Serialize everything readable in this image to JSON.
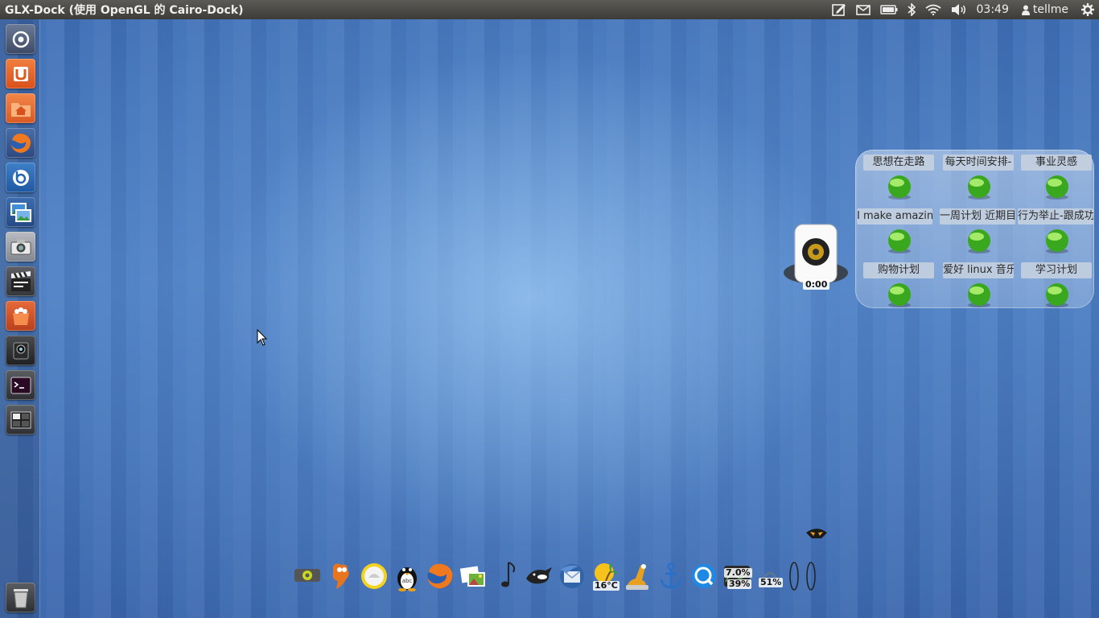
{
  "top_panel": {
    "window_title": "GLX-Dock (使用 OpenGL 的 Cairo-Dock)",
    "clock": "03:49",
    "user": "tellme",
    "icons": [
      "notes-icon",
      "mail-icon",
      "battery-icon",
      "bluetooth-icon",
      "wifi-icon",
      "volume-icon",
      "user-icon",
      "power-gear-icon"
    ]
  },
  "launcher": {
    "items": [
      {
        "name": "dash-home-icon"
      },
      {
        "name": "ubuntu-software-center-icon"
      },
      {
        "name": "home-folder-icon"
      },
      {
        "name": "firefox-icon"
      },
      {
        "name": "blue-app-icon"
      },
      {
        "name": "image-viewer-icon"
      },
      {
        "name": "camera-icon"
      },
      {
        "name": "video-editor-icon"
      },
      {
        "name": "orange-app-icon"
      },
      {
        "name": "webcam-icon"
      },
      {
        "name": "terminal-icon"
      },
      {
        "name": "workspace-switcher-icon"
      },
      {
        "name": "trash-icon"
      }
    ]
  },
  "audio_widget": {
    "time": "0:00"
  },
  "notes_panel": {
    "notes": [
      {
        "label": "思想在走路"
      },
      {
        "label": "每天时间安排-"
      },
      {
        "label": "事业灵感"
      },
      {
        "label": "I make amazing"
      },
      {
        "label": "一周计划 近期目"
      },
      {
        "label": "行为举止-跟成功"
      },
      {
        "label": "购物计划"
      },
      {
        "label": "爱好 linux 音乐"
      },
      {
        "label": "学习计划"
      }
    ]
  },
  "dock": {
    "items": [
      {
        "name": "system-settings-icon"
      },
      {
        "name": "gimp-icon"
      },
      {
        "name": "yellow-circle-icon"
      },
      {
        "name": "qq-penguin-icon"
      },
      {
        "name": "firefox-dock-icon"
      },
      {
        "name": "photos-icon"
      },
      {
        "name": "music-note-icon"
      },
      {
        "name": "orca-icon"
      },
      {
        "name": "thunderbird-icon"
      },
      {
        "name": "weather-icon",
        "label": "16°C"
      },
      {
        "name": "cairo-dock-icon"
      },
      {
        "name": "anchor-icon"
      },
      {
        "name": "quicktime-icon"
      },
      {
        "name": "system-monitor-icon",
        "label_top": "7.0%",
        "label_bottom": "39%"
      },
      {
        "name": "battery-dock-icon",
        "label": "51%"
      },
      {
        "name": "separator-icon"
      }
    ]
  }
}
